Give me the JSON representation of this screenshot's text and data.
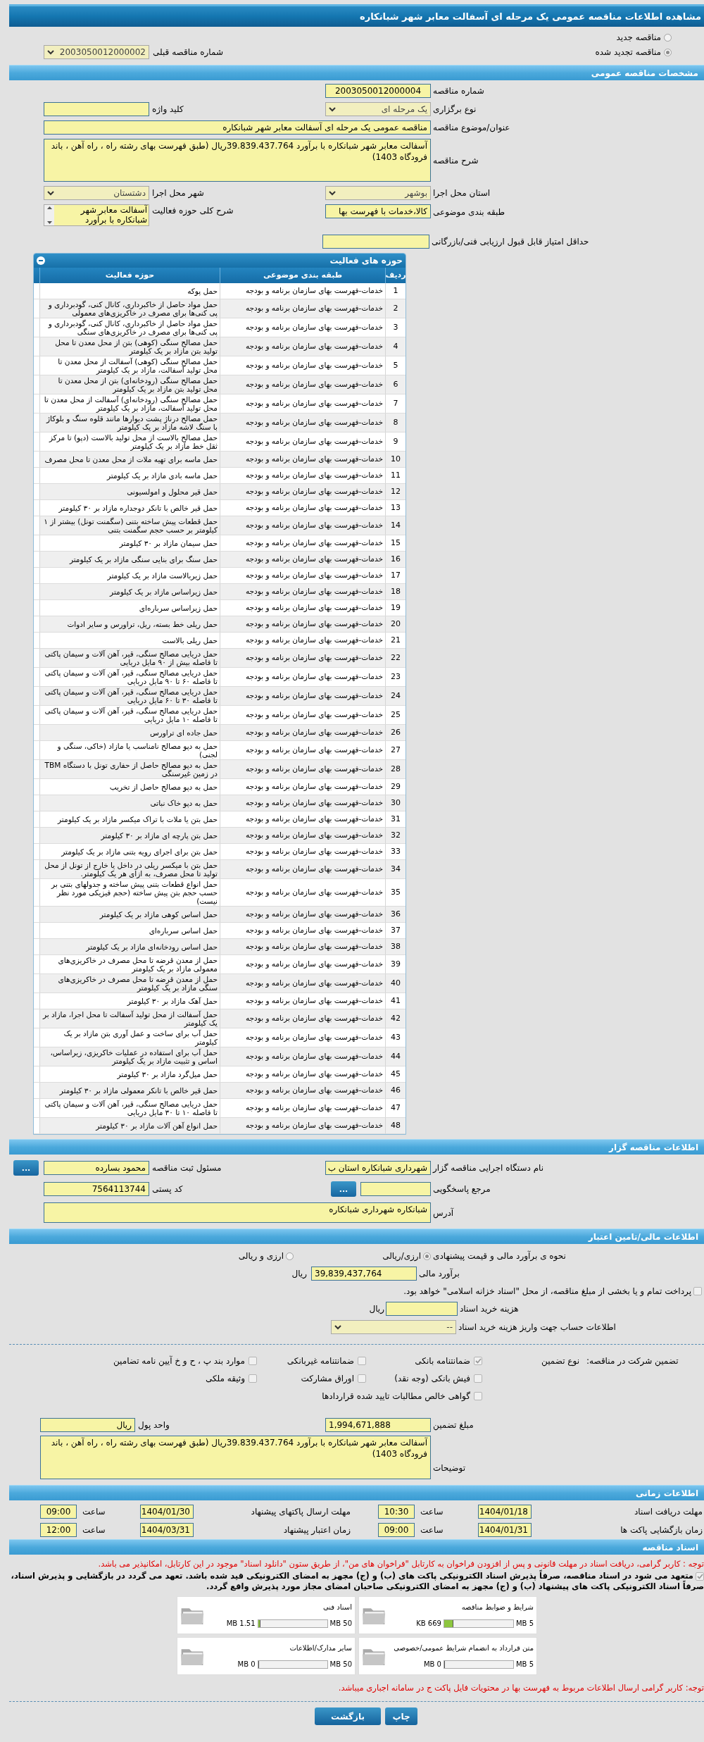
{
  "page_title": "مشاهده اطلاعات مناقصه عمومی یک مرحله ای آسفالت معابر شهر شبانکاره",
  "tender_status": [
    {
      "label": "مناقصه جدید",
      "selected": false
    },
    {
      "label": "مناقصه تجدید شده",
      "selected": true
    }
  ],
  "previous_tender": {
    "label": "شماره مناقصه قبلی",
    "value": "2003050012000002"
  },
  "general": {
    "title": "مشخصات مناقصه عمومی",
    "tender_number": {
      "label": "شماره مناقصه",
      "value": "2003050012000004"
    },
    "holding_type": {
      "label": "نوع برگزاری",
      "value": "یک مرحله ای"
    },
    "keyword": {
      "label": "کلید واژه"
    },
    "subject": {
      "label": "عنوان/موضوع مناقصه",
      "value": "مناقصه عمومی یک مرحله ای آسفالت معابر شهر شبانکاره"
    },
    "description": {
      "label": "شرح مناقصه",
      "value": "آسفالت معابر شهر شبانکاره  با برآورد 39.839.437.764ریال (طبق فهرست بهای رشته راه ، راه آهن ، باند فرودگاه 1403)"
    },
    "province": {
      "label": "استان محل اجرا",
      "value": "بوشهر"
    },
    "city": {
      "label": "شهر محل اجرا",
      "value": "دشتستان"
    },
    "category": {
      "label": "طبقه بندی موضوعی",
      "value": "کالا،خدمات با فهرست بها"
    },
    "activity_summary": {
      "label": "شرح کلی حوزه فعالیت",
      "value": "آسفالت معابر شهر شبانکاره  با برآورد"
    },
    "min_score": {
      "label": "حداقل امتیاز قابل قبول ارزیابی فنی/بازرگانی"
    }
  },
  "activities": {
    "title": "حوزه های فعالیت",
    "expanded": true,
    "columns": [
      "ردیف",
      "طبقه بندی موضوعی",
      "حوزه فعالیت"
    ],
    "rows": [
      {
        "index": "1",
        "category": "خدمات-فهرست بهای سازمان برنامه و بودجه",
        "activity": "حمل پوکه"
      },
      {
        "index": "2",
        "category": "خدمات-فهرست بهای سازمان برنامه و بودجه",
        "activity": "حمل مواد حاصل از خاکبرداری، کانال کنی، گودبرداری و پی کنی‌ها برای مصرف در خاکریزی‌های معمولی"
      },
      {
        "index": "3",
        "category": "خدمات-فهرست بهای سازمان برنامه و بودجه",
        "activity": "حمل مواد حاصل از خاکبرداری، کانال کنی، گودبرداری و پی کنی‌ها برای مصرف در خاکریزی‌های سنگی"
      },
      {
        "index": "4",
        "category": "خدمات-فهرست بهای سازمان برنامه و بودجه",
        "activity": "حمل مصالح سنگی (کوهی) بتن از محل معدن تا محل تولید بتن مازاد بر یک کیلومتر"
      },
      {
        "index": "5",
        "category": "خدمات-فهرست بهای سازمان برنامه و بودجه",
        "activity": "حمل مصالح سنگی (کوهی) آسفالت از محل معدن تا محل تولید آسفالت، مازاد بر یک کیلومتر"
      },
      {
        "index": "6",
        "category": "خدمات-فهرست بهای سازمان برنامه و بودجه",
        "activity": "حمل مصالح سنگی (رودخانه‌ای) بتن از محل معدن تا محل تولید بتن مازاد بر یک کیلومتر"
      },
      {
        "index": "7",
        "category": "خدمات-فهرست بهای سازمان برنامه و بودجه",
        "activity": "حمل مصالح سنگی (رودخانه‌ای) آسفالت از محل معدن تا محل تولید آسفالت، مازاد بر یک کیلومتر"
      },
      {
        "index": "8",
        "category": "خدمات-فهرست بهای سازمان برنامه و بودجه",
        "activity": "حمل مصالح درناژ پشت دیوارها مانند قلوه سنگ و بلوکاژ با سنگ لاشه مازاد بر یک کیلومتر"
      },
      {
        "index": "9",
        "category": "خدمات-فهرست بهای سازمان برنامه و بودجه",
        "activity": "حمل مصالح بالاست از محل تولید بالاست (دپو) تا مرکز ثقل خط مازاد بر یک کیلومتر"
      },
      {
        "index": "10",
        "category": "خدمات-فهرست بهای سازمان برنامه و بودجه",
        "activity": "حمل ماسه برای تهیه ملات از محل معدن تا محل مصرف"
      },
      {
        "index": "11",
        "category": "خدمات-فهرست بهای سازمان برنامه و بودجه",
        "activity": "حمل ماسه بادی مازاد بر یک کیلومتر"
      },
      {
        "index": "12",
        "category": "خدمات-فهرست بهای سازمان برنامه و بودجه",
        "activity": "حمل قیر محلول و امولسیونی"
      },
      {
        "index": "13",
        "category": "خدمات-فهرست بهای سازمان برنامه و بودجه",
        "activity": "حمل قیر خالص با تانکر دوجداره مازاد بر ۳۰ کیلومتر"
      },
      {
        "index": "14",
        "category": "خدمات-فهرست بهای سازمان برنامه و بودجه",
        "activity": "حمل قطعات پیش ساخته بتنی (سگمنت تونل) بیشتر از ۱ کیلومتر بر حسب حجم سگمنت بتنی"
      },
      {
        "index": "15",
        "category": "خدمات-فهرست بهای سازمان برنامه و بودجه",
        "activity": "حمل سیمان مازاد بر ۳۰ کیلومتر"
      },
      {
        "index": "16",
        "category": "خدمات-فهرست بهای سازمان برنامه و بودجه",
        "activity": "حمل سنگ برای بنایی سنگی مازاد بر یک کیلومتر"
      },
      {
        "index": "17",
        "category": "خدمات-فهرست بهای سازمان برنامه و بودجه",
        "activity": "حمل زیربالاست مازاد بر یک کیلومتر"
      },
      {
        "index": "18",
        "category": "خدمات-فهرست بهای سازمان برنامه و بودجه",
        "activity": "حمل زیراساس مازاد بر یک کیلومتر"
      },
      {
        "index": "19",
        "category": "خدمات-فهرست بهای سازمان برنامه و بودجه",
        "activity": "حمل زیراساس سرباره‌ای"
      },
      {
        "index": "20",
        "category": "خدمات-فهرست بهای سازمان برنامه و بودجه",
        "activity": "حمل ریلی خط بسته، ریل، تراورس و سایر ادوات"
      },
      {
        "index": "21",
        "category": "خدمات-فهرست بهای سازمان برنامه و بودجه",
        "activity": "حمل ریلی بالاست"
      },
      {
        "index": "22",
        "category": "خدمات-فهرست بهای سازمان برنامه و بودجه",
        "activity": "حمل دریایی مصالح سنگی،  قیر، آهن آلات و سیمان پاکتی تا فاصله بیش از ۹۰ مایل دریایی"
      },
      {
        "index": "23",
        "category": "خدمات-فهرست بهای سازمان برنامه و بودجه",
        "activity": "حمل دریایی مصالح سنگی، قیر، آهن آلات و سیمان پاکتی تا فاصله ۶۰ تا ۹۰ مایل دریایی"
      },
      {
        "index": "24",
        "category": "خدمات-فهرست بهای سازمان برنامه و بودجه",
        "activity": "حمل دریایی مصالح سنگی، قیر، آهن آلات و سیمان پاکتی تا فاصله ۳۰ تا ۶۰ مایل دریایی"
      },
      {
        "index": "25",
        "category": "خدمات-فهرست بهای سازمان برنامه و بودجه",
        "activity": "حمل دریایی مصالح سنگی، قیر، آهن آلات و سیمان پاکتی تا فاصله ۱۰ مایل دریایی"
      },
      {
        "index": "26",
        "category": "خدمات-فهرست بهای سازمان برنامه و بودجه",
        "activity": "حمل جاده ای تراورس"
      },
      {
        "index": "27",
        "category": "خدمات-فهرست بهای سازمان برنامه و بودجه",
        "activity": "حمل به دپو مصالح نامناسب یا مازاد (خاکی، سنگی و لجنی)"
      },
      {
        "index": "28",
        "category": "خدمات-فهرست بهای سازمان برنامه و بودجه",
        "activity": "حمل به دپو مصالح حاصل از حفاری تونل با دستگاه TBM در زمین غیرسنگی"
      },
      {
        "index": "29",
        "category": "خدمات-فهرست بهای سازمان برنامه و بودجه",
        "activity": "حمل به دپو مصالح حاصل از تخریب"
      },
      {
        "index": "30",
        "category": "خدمات-فهرست بهای سازمان برنامه و بودجه",
        "activity": "حمل به دپو خاک نباتی"
      },
      {
        "index": "31",
        "category": "خدمات-فهرست بهای سازمان برنامه و بودجه",
        "activity": "حمل بتن یا ملات با تراک میکسر مازاد بر یک کیلومتر"
      },
      {
        "index": "32",
        "category": "خدمات-فهرست بهای سازمان برنامه و بودجه",
        "activity": "حمل بتن پارچه ای مازاد بر ۳۰ کیلومتر"
      },
      {
        "index": "33",
        "category": "خدمات-فهرست بهای سازمان برنامه و بودجه",
        "activity": "حمل بتن برای اجرای رویه بتنی مازاد بر یک کیلومتر"
      },
      {
        "index": "34",
        "category": "خدمات-فهرست بهای سازمان برنامه و بودجه",
        "activity": "حمل بتن با میکسر ریلی در داخل یا خارج از تونل از محل تولید تا محل مصرف، به ازای هر یک کیلومتر."
      },
      {
        "index": "35",
        "category": "خدمات-فهرست بهای سازمان برنامه و بودجه",
        "activity": "حمل انواع قطعات بتنی پیش ساخته و جدولهای بتنی بر حسب حجم بتن پیش ساخته (حجم فیزیکی مورد نظر نیست)"
      },
      {
        "index": "36",
        "category": "خدمات-فهرست بهای سازمان برنامه و بودجه",
        "activity": "حمل اساس کوهی مازاد بر یک کیلومتر"
      },
      {
        "index": "37",
        "category": "خدمات-فهرست بهای سازمان برنامه و بودجه",
        "activity": "حمل اساس سرباره‌ای"
      },
      {
        "index": "38",
        "category": "خدمات-فهرست بهای سازمان برنامه و بودجه",
        "activity": "حمل اساس رودخانه‌ای مازاد بر یک کیلومتر"
      },
      {
        "index": "39",
        "category": "خدمات-فهرست بهای سازمان برنامه و بودجه",
        "activity": "حمل از معدن قرضه تا محل مصرف در خاکریزی‌های معمولی مازاد بر یک کیلومتر"
      },
      {
        "index": "40",
        "category": "خدمات-فهرست بهای سازمان برنامه و بودجه",
        "activity": "حمل از معدن قرضه تا محل مصرف در خاکریزی‌های سنگی مازاد بر یک کیلومتر"
      },
      {
        "index": "41",
        "category": "خدمات-فهرست بهای سازمان برنامه و بودجه",
        "activity": "حمل آهک مازاد بر ۳۰ کیلومتر"
      },
      {
        "index": "42",
        "category": "خدمات-فهرست بهای سازمان برنامه و بودجه",
        "activity": "حمل آسفالت از محل تولید آسفالت تا محل اجرا، مازاد بر یک کیلومتر"
      },
      {
        "index": "43",
        "category": "خدمات-فهرست بهای سازمان برنامه و بودجه",
        "activity": "حمل آب برای ساخت و عمل آوری بتن مازاد بر یک کیلومتر"
      },
      {
        "index": "44",
        "category": "خدمات-فهرست بهای سازمان برنامه و بودجه",
        "activity": "حمل آب برای استفاده در عملیات خاکریزی، زیراساس، اساس و تثبیت مازاد بر یک کیلومتر"
      },
      {
        "index": "45",
        "category": "خدمات-فهرست بهای سازمان برنامه و بودجه",
        "activity": "حمل میل‌گرد مازاد بر ۳۰ کیلومتر"
      },
      {
        "index": "46",
        "category": "خدمات-فهرست بهای سازمان برنامه و بودجه",
        "activity": "حمل قیر خالص با تانکر معمولی مازاد بر ۳۰ کیلومتر"
      },
      {
        "index": "47",
        "category": "خدمات-فهرست بهای سازمان برنامه و بودجه",
        "activity": "حمل دریایی مصالح سنگی، قیر، آهن آلات و سیمان پاکتی تا فاصله ۱۰ تا ۳۰ مایل دریایی"
      },
      {
        "index": "48",
        "category": "خدمات-فهرست بهای سازمان برنامه و بودجه",
        "activity": "حمل انواع آهن آلات مازاد بر ۳۰ کیلومتر"
      }
    ]
  },
  "organizer": {
    "title": "اطلاعات مناقصه گزار",
    "agency": {
      "label": "نام دستگاه اجرایی مناقصه گزار",
      "value": "شهرداری شبانکاره استان ب"
    },
    "registrar": {
      "label": "مسئول ثبت مناقصه",
      "value": "محمود بسارده",
      "button": "..."
    },
    "reference": {
      "label": "مرجع پاسخگویی",
      "button": "..."
    },
    "postal_code": {
      "label": "کد پستی",
      "value": "7564113744"
    },
    "address": {
      "label": "آدرس",
      "value": "شبانکاره شهرداری شبانکاره"
    }
  },
  "finance": {
    "title": "اطلاعات مالی/تامین اعتبار",
    "estimate_method": {
      "label": "نحوه ی برآورد مالی و قیمت پیشنهادی",
      "options": [
        {
          "label": "ارزی/ریالی",
          "selected": true
        },
        {
          "label": "ارزی و ریالی",
          "selected": false
        }
      ]
    },
    "budget": {
      "label": "برآورد مالی",
      "value": "39,839,437,764",
      "unit": "ریال"
    },
    "treasury": {
      "label": "پرداخت تمام و یا بخشی از مبلغ مناقصه، از محل \"اسناد خزانه اسلامی\" خواهد بود.",
      "checked": false
    },
    "doc_fee": {
      "label": "هزینه خرید اسناد",
      "unit": "ریال"
    },
    "account": {
      "label": "اطلاعات حساب جهت واریز هزینه خرید اسناد",
      "value": "--"
    }
  },
  "guarantee": {
    "label": "تضمین شرکت در مناقصه:",
    "type_label": "نوع تضمین",
    "options": [
      {
        "label": "ضمانتنامه بانکی",
        "checked": true
      },
      {
        "label": "ضمانتنامه غیربانکی",
        "checked": false
      },
      {
        "label": "موارد بند پ ، ح و خ آیین نامه تضامین",
        "checked": false
      },
      {
        "label": "فیش بانکی (وجه نقد)",
        "checked": false
      },
      {
        "label": "اوراق مشارکت",
        "checked": false
      },
      {
        "label": "وثیقه ملکی",
        "checked": false
      },
      {
        "label": "گواهی خالص مطالبات تایید شده قراردادها",
        "checked": false
      }
    ],
    "amount": {
      "label": "مبلغ تضمین",
      "value": "1,994,671,888"
    },
    "currency": {
      "label": "واحد پول",
      "value": "ریال"
    },
    "notes": {
      "label": "توضیحات",
      "value": "آسفالت معابر شهر شبانکاره  با برآورد 39.839.437.764ریال (طبق فهرست بهای رشته راه ، راه آهن ، باند فرودگاه 1403)"
    }
  },
  "timing": {
    "title": "اطلاعات زمانی",
    "items": [
      {
        "label": "مهلت دریافت اسناد",
        "date": "1404/01/18",
        "time_label": "ساعت",
        "time": "10:30"
      },
      {
        "label": "مهلت ارسال پاکتهای پیشنهاد",
        "date": "1404/01/30",
        "time_label": "ساعت",
        "time": "09:00"
      },
      {
        "label": "زمان بازگشایی پاکت ها",
        "date": "1404/01/31",
        "time_label": "ساعت",
        "time": "09:00"
      },
      {
        "label": "زمان اعتبار پیشنهاد",
        "date": "1404/03/31",
        "time_label": "ساعت",
        "time": "12:00"
      }
    ]
  },
  "documents": {
    "title": "اسناد مناقصه",
    "notice": "توجه : کاربر گرامی، دریافت اسناد در مهلت قانونی و پس از افزودن فراخوان به کارتابل \"فراخوان های من\"، از طریق ستون \"دانلود اسناد\" موجود در این کارتابل، امکانپذیر می باشد.",
    "commitment": {
      "text": "متعهد می شود در اسناد مناقصه، صرفاً پذیرش اسناد الکترونیکی پاکت های (ب) و (ج) مجهز به امضای الکترونیکی قید شده باشد. تعهد می گردد در بازگشایی و پذیرش اسناد، صرفاً اسناد الکترونیکی پاکت های پیشنهاد (ب) و (ج) مجهز به امضای الکترونیکی صاحبان امضای مجاز مورد پذیرش واقع گردد.",
      "checked": true
    },
    "files": [
      {
        "title": "شرایط و ضوابط مناقصه",
        "used": "669 KB",
        "max": "5 MB",
        "level": 0.13
      },
      {
        "title": "اسناد فنی",
        "used": "1.51 MB",
        "max": "50 MB",
        "level": 0.03
      },
      {
        "title": "متن قرارداد به انضمام شرایط عمومی/خصوصی",
        "used": "0 MB",
        "max": "5 MB",
        "level": 0
      },
      {
        "title": "سایر مدارک/اطلاعات",
        "used": "0 MB",
        "max": "50 MB",
        "level": 0
      }
    ],
    "footer_notice": "توجه: کاربر گرامی ارسال اطلاعات مربوط به فهرست بها در محتویات فایل پاکت ج در سامانه اجباری میباشد."
  },
  "buttons": [
    {
      "label": "چاپ"
    },
    {
      "label": "بازگشت"
    }
  ]
}
